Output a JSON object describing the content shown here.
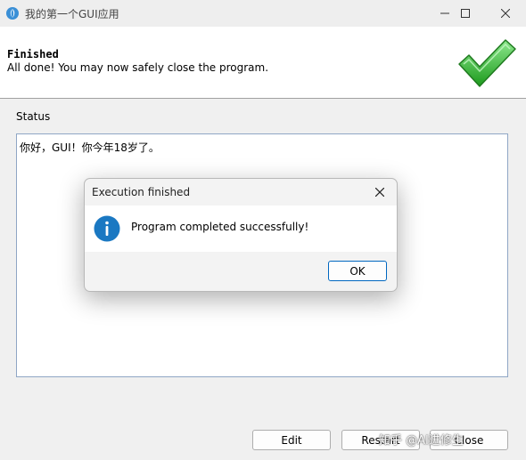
{
  "window": {
    "title": "我的第一个GUI应用",
    "controls": [
      "minimize-icon",
      "maximize-icon",
      "close-icon"
    ]
  },
  "header": {
    "title": "Finished",
    "subtitle": "All done! You may now safely close the program.",
    "icon": "green-checkmark-icon"
  },
  "status": {
    "label": "Status",
    "text": "你好，GUI！你今年18岁了。"
  },
  "buttons": {
    "edit": "Edit",
    "restart": "Restart",
    "close": "Close"
  },
  "watermark": "知乎 @AI进修生",
  "dialog": {
    "title": "Execution finished",
    "message": "Program completed successfully!",
    "ok_label": "OK",
    "icon": "info-icon"
  },
  "colors": {
    "accent": "#0067c0",
    "info_icon": "#1a78c2",
    "check": "#2fb52f"
  }
}
